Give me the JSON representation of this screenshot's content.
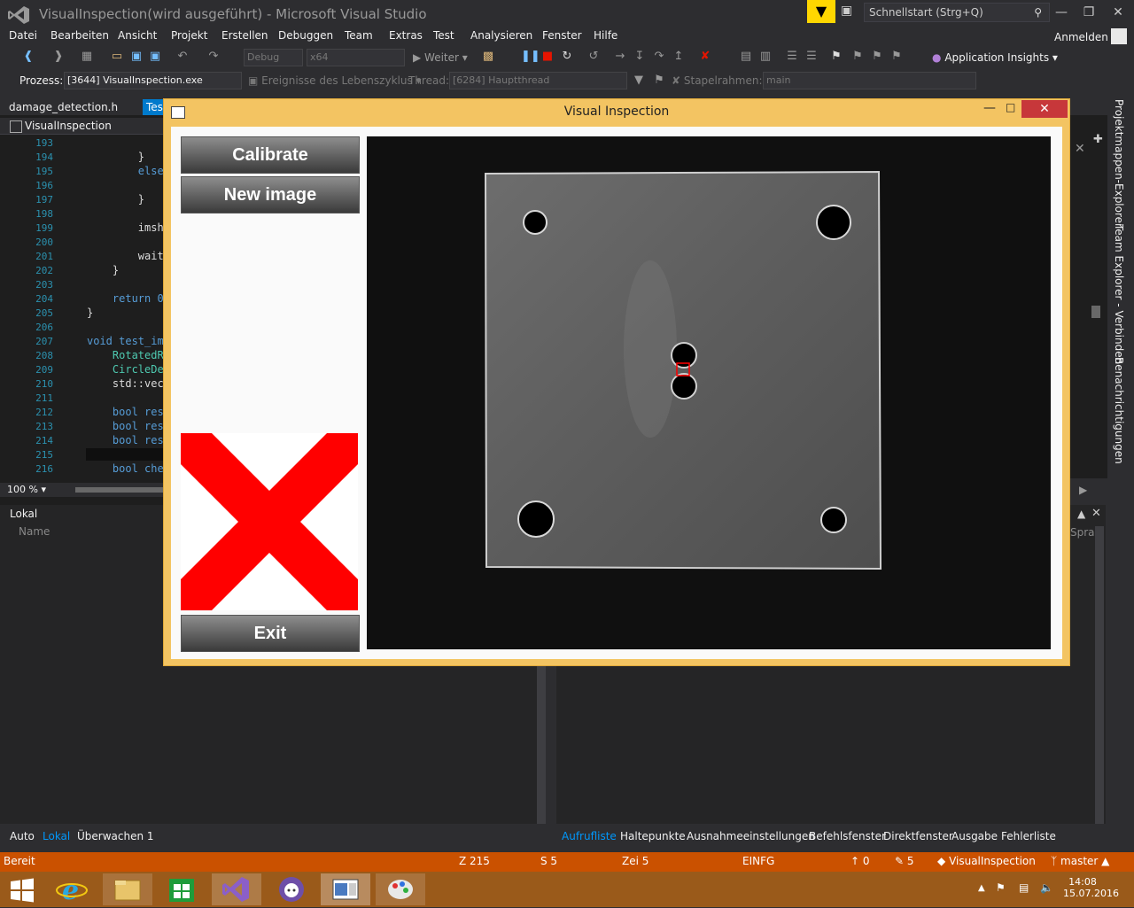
{
  "window": {
    "title": "VisualInspection(wird ausgeführt) - Microsoft Visual Studio",
    "quick_launch_placeholder": "Schnellstart (Strg+Q)",
    "sign_in": "Anmelden"
  },
  "menu": [
    "Datei",
    "Bearbeiten",
    "Ansicht",
    "Projekt",
    "Erstellen",
    "Debuggen",
    "Team",
    "Extras",
    "Test",
    "Analysieren",
    "Fenster",
    "Hilfe"
  ],
  "toolbar": {
    "config": "Debug",
    "platform": "x64",
    "continue": "Weiter",
    "app_insights": "Application Insights"
  },
  "debug_bar": {
    "process_label": "Prozess:",
    "process_value": "[3644] VisualInspection.exe",
    "lifecycle_label": "Ereignisse des Lebenszyklus",
    "thread_label": "Thread:",
    "thread_value": "[6284] Hauptthread",
    "stackframe_label": "Stapelrahmen:",
    "stackframe_value": "main"
  },
  "editor": {
    "tab_file": "damage_detection.h",
    "tab_active": "Tes",
    "nav_project": "VisualInspection",
    "zoom": "100 %",
    "lines": [
      {
        "n": "193",
        "code": ""
      },
      {
        "n": "194",
        "code": "        }"
      },
      {
        "n": "195",
        "code": "        else"
      },
      {
        "n": "196",
        "code": "            "
      },
      {
        "n": "197",
        "code": "        }"
      },
      {
        "n": "198",
        "code": ""
      },
      {
        "n": "199",
        "code": "        imsho"
      },
      {
        "n": "200",
        "code": ""
      },
      {
        "n": "201",
        "code": "        wait"
      },
      {
        "n": "202",
        "code": "    }"
      },
      {
        "n": "203",
        "code": ""
      },
      {
        "n": "204",
        "code": "    return 0"
      },
      {
        "n": "205",
        "code": "}"
      },
      {
        "n": "206",
        "code": ""
      },
      {
        "n": "207",
        "code": "void test_ima"
      },
      {
        "n": "208",
        "code": "    RotatedRe"
      },
      {
        "n": "209",
        "code": "    CircleDet"
      },
      {
        "n": "210",
        "code": "    std::vect"
      },
      {
        "n": "211",
        "code": ""
      },
      {
        "n": "212",
        "code": "    bool resu"
      },
      {
        "n": "213",
        "code": "    bool resu"
      },
      {
        "n": "214",
        "code": "    bool resu"
      },
      {
        "n": "215",
        "code": "    "
      },
      {
        "n": "216",
        "code": "    bool chec"
      }
    ]
  },
  "locals_panel": {
    "title": "Lokal",
    "column_name": "Name",
    "right_partial": "Spra"
  },
  "bottom_tabs_left": [
    "Auto",
    "Lokal",
    "Überwachen 1"
  ],
  "bottom_tabs_right": [
    "Aufrufliste",
    "Haltepunkte",
    "Ausnahmeeinstellungen",
    "Befehlsfenster",
    "Direktfenster",
    "Ausgabe",
    "Fehlerliste"
  ],
  "side_tabs": [
    "Projektmappen-Explorer",
    "Team Explorer - Verbinden",
    "Benachrichtigungen"
  ],
  "status": {
    "ready": "Bereit",
    "line": "Z 215",
    "col": "S 5",
    "char": "Zei 5",
    "mode": "EINFG",
    "up": "0",
    "edits": "5",
    "repo": "VisualInspection",
    "branch": "master"
  },
  "clock": {
    "time": "14:08",
    "date": "15.07.2016"
  },
  "dialog": {
    "title": "Visual Inspection",
    "calibrate": "Calibrate",
    "new_image": "New image",
    "exit": "Exit",
    "result": "fail"
  },
  "colors": {
    "accent": "#007acc",
    "status_bar": "#ca5100",
    "dialog_frame": "#f3c462",
    "fail_red": "#ff0000"
  }
}
